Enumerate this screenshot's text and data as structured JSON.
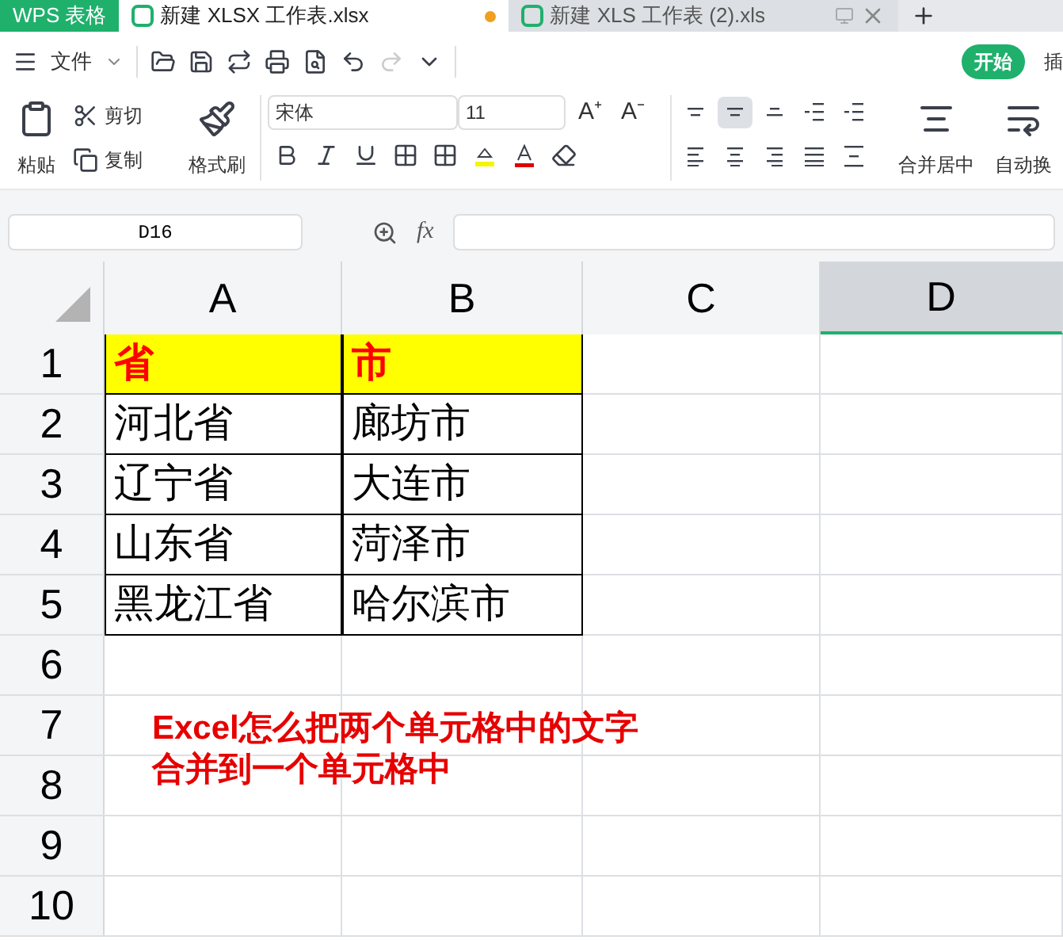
{
  "tabs": [
    {
      "kind": "app",
      "label": "WPS 表格",
      "selected": false
    },
    {
      "kind": "doc",
      "label": "新建 XLSX 工作表.xlsx",
      "selected": true,
      "modified": true
    },
    {
      "kind": "doc",
      "label": "新建 XLS 工作表 (2).xls",
      "selected": false,
      "modified": false
    }
  ],
  "menu": {
    "file": "文件",
    "ribbon_tabs": [
      {
        "label": "开始",
        "selected": true
      },
      {
        "label": "插",
        "selected": false
      }
    ]
  },
  "ribbon": {
    "paste": "粘贴",
    "cut": "剪切",
    "copy": "复制",
    "format_painter": "格式刷",
    "font_name": "宋体",
    "font_size": "11",
    "grow_font": "A⁺",
    "shrink_font": "A⁻",
    "align_top": [
      {
        "kind": "top",
        "selected": false
      },
      {
        "kind": "middle",
        "selected": true
      },
      {
        "kind": "bottom",
        "selected": false
      },
      {
        "kind": "outdent",
        "selected": false
      },
      {
        "kind": "indent",
        "selected": false
      }
    ],
    "align_bottom": [
      {
        "kind": "left",
        "selected": false
      },
      {
        "kind": "center",
        "selected": false
      },
      {
        "kind": "right",
        "selected": false
      },
      {
        "kind": "justify",
        "selected": false
      },
      {
        "kind": "distributed",
        "selected": false
      }
    ],
    "merge": "合并居中",
    "wrap": "自动换"
  },
  "name_box": "D16",
  "function_label": "fx",
  "columns": [
    {
      "label": "A",
      "selected": false
    },
    {
      "label": "B",
      "selected": false
    },
    {
      "label": "C",
      "selected": false
    },
    {
      "label": "D",
      "selected": true
    }
  ],
  "rows": [
    {
      "label": "1",
      "cells": [
        {
          "text": "省",
          "highlight": true
        },
        {
          "text": "市",
          "highlight": true
        }
      ]
    },
    {
      "label": "2",
      "cells": [
        {
          "text": "河北省",
          "highlight": false
        },
        {
          "text": "廊坊市",
          "highlight": false
        }
      ]
    },
    {
      "label": "3",
      "cells": [
        {
          "text": "辽宁省",
          "highlight": false
        },
        {
          "text": "大连市",
          "highlight": false
        }
      ]
    },
    {
      "label": "4",
      "cells": [
        {
          "text": "山东省",
          "highlight": false
        },
        {
          "text": "菏泽市",
          "highlight": false
        }
      ]
    },
    {
      "label": "5",
      "cells": [
        {
          "text": "黑龙江省",
          "highlight": false
        },
        {
          "text": "哈尔滨市",
          "highlight": false
        }
      ]
    },
    {
      "label": "6",
      "cells": []
    },
    {
      "label": "7",
      "cells": []
    },
    {
      "label": "8",
      "cells": []
    },
    {
      "label": "9",
      "cells": []
    },
    {
      "label": "10",
      "cells": []
    }
  ],
  "annotation": [
    "Excel怎么把两个单元格中的文字",
    "合并到一个单元格中"
  ]
}
